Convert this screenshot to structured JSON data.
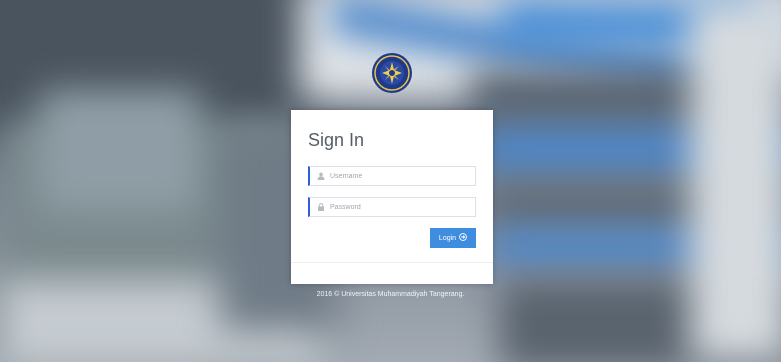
{
  "login": {
    "title": "Sign In",
    "username_placeholder": "Username",
    "password_placeholder": "Password",
    "login_label": "Login"
  },
  "footer": {
    "text": "2016 © Universitas Muhammadiyah Tangerang."
  },
  "icons": {
    "username": "user-icon",
    "password": "lock-icon",
    "login": "arrow-circle-right-icon",
    "logo": "university-seal-logo"
  },
  "colors": {
    "accent": "#2f5fd0",
    "button": "#3e8ddf",
    "card": "#ffffff"
  }
}
